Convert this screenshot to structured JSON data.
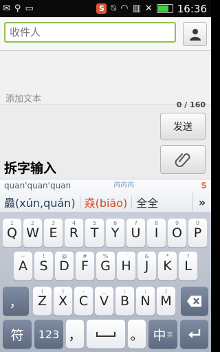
{
  "status_bar": {
    "time": "16:36",
    "sogou": "S"
  },
  "compose": {
    "recipient_placeholder": "收件人",
    "text_placeholder": "添加文本",
    "counter": "0 / 160",
    "send_label": "发送",
    "overlay_label": "拆字输入"
  },
  "ime": {
    "pinyin": "quan'quan'quan",
    "pinyin_icon": "𠀛𠀛𠀛",
    "logo": "S",
    "candidates": [
      "灥(xún,quán)",
      "猋(biāo)",
      "全全"
    ],
    "more": "»"
  },
  "keyboard": {
    "row1": [
      {
        "main": "Q",
        "sub": "1"
      },
      {
        "main": "W",
        "sub": "2"
      },
      {
        "main": "E",
        "sub": "3"
      },
      {
        "main": "R",
        "sub": "4"
      },
      {
        "main": "T",
        "sub": "5"
      },
      {
        "main": "Y",
        "sub": "6"
      },
      {
        "main": "U",
        "sub": "7"
      },
      {
        "main": "I",
        "sub": "8"
      },
      {
        "main": "O",
        "sub": "9"
      },
      {
        "main": "P",
        "sub": "0"
      }
    ],
    "row2": [
      {
        "main": "A",
        "sub": "~"
      },
      {
        "main": "S",
        "sub": "!"
      },
      {
        "main": "D",
        "sub": "@"
      },
      {
        "main": "F",
        "sub": "#"
      },
      {
        "main": "G",
        "sub": "%"
      },
      {
        "main": "H",
        "sub": "'"
      },
      {
        "main": "J",
        "sub": "&"
      },
      {
        "main": "K",
        "sub": "*"
      },
      {
        "main": "L",
        "sub": "?"
      }
    ],
    "row3": [
      {
        "main": "Z",
        "sub": "("
      },
      {
        "main": "X",
        "sub": ")"
      },
      {
        "main": "C",
        "sub": "-"
      },
      {
        "main": "V",
        "sub": "_"
      },
      {
        "main": "B",
        "sub": ":"
      },
      {
        "main": "N",
        "sub": ";"
      },
      {
        "main": "M",
        "sub": "/"
      }
    ],
    "shift_label": "，",
    "symbols_label": "符",
    "numbers_label": "123",
    "comma_label": "，",
    "period_label": "。",
    "lang_label": "中",
    "lang_sub": "英"
  }
}
